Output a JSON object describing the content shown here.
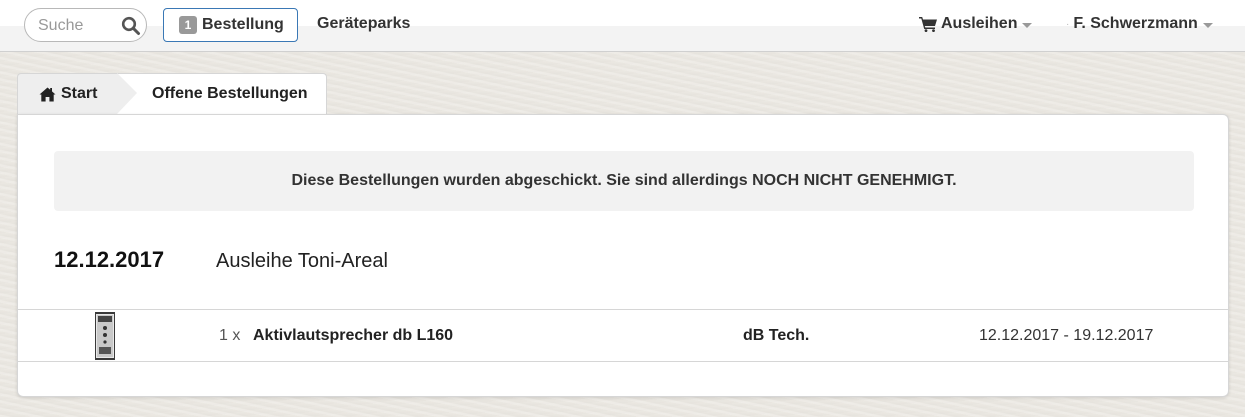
{
  "topbar": {
    "search_placeholder": "Suche",
    "order_badge": "1",
    "order_label": "Bestellung",
    "parks_label": "Geräteparks",
    "ausleihen_label": "Ausleihen",
    "user_name": "F. Schwerzmann"
  },
  "breadcrumb": {
    "start_label": "Start",
    "current_label": "Offene Bestellungen"
  },
  "alert": {
    "text": "Diese Bestellungen wurden abgeschickt. Sie sind allerdings NOCH NICHT GENEHMIGT."
  },
  "order": {
    "date": "12.12.2017",
    "title": "Ausleihe Toni-Areal",
    "items": [
      {
        "qty": "1 x",
        "name": "Aktivlautsprecher db L160",
        "brand": "dB Tech.",
        "period": "12.12.2017 - 19.12.2017"
      }
    ]
  },
  "colors": {
    "accent_border": "#3a78b5",
    "badge_bg": "#999999",
    "alert_bg": "#f2f2f2"
  },
  "icons": {
    "search": "search-icon",
    "cart": "cart-icon",
    "home": "home-icon",
    "caret": "chevron-down-icon"
  }
}
